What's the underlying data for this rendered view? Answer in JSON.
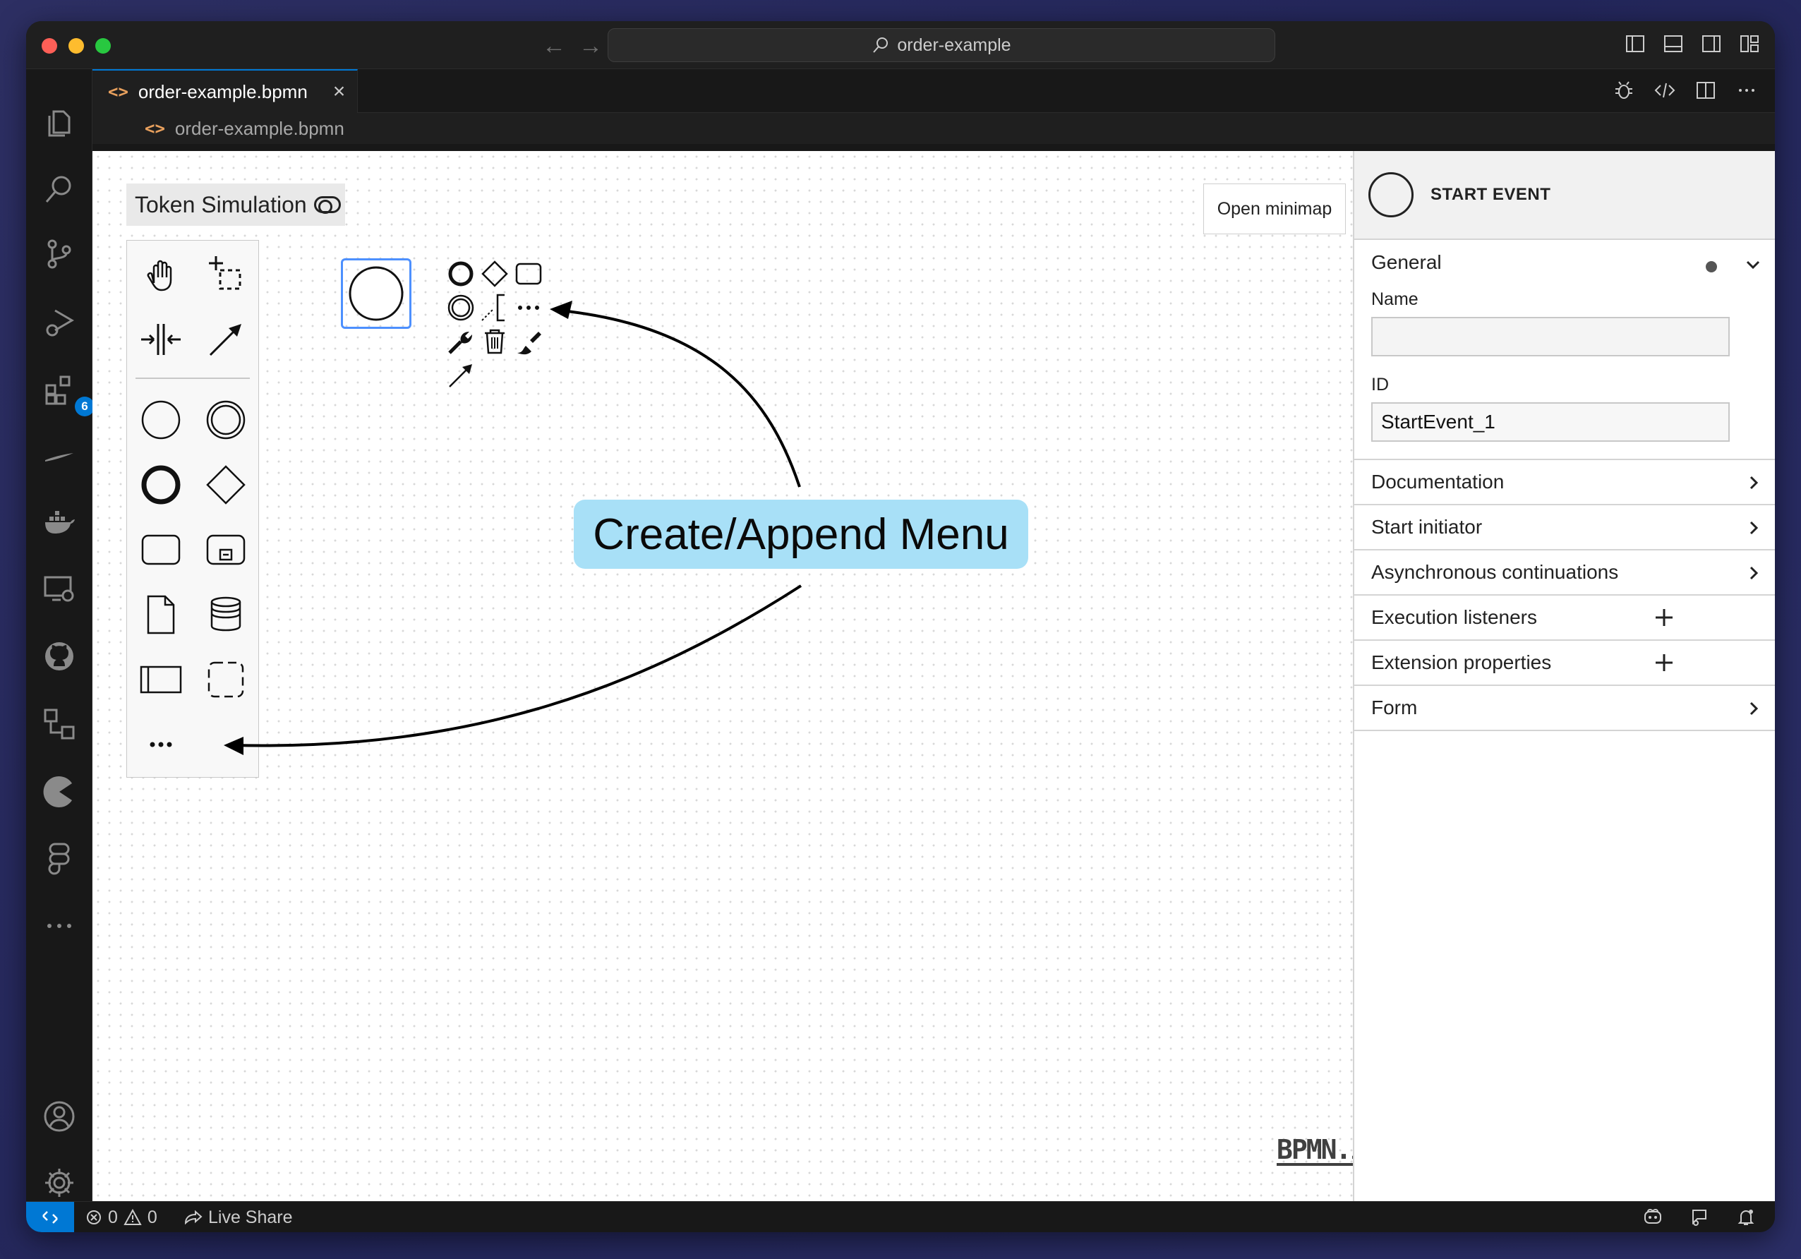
{
  "window": {
    "search_text": "order-example",
    "nav_back": "←",
    "nav_forward": "→"
  },
  "activity_bar": {
    "items": [
      {
        "name": "explorer",
        "icon": "files-icon"
      },
      {
        "name": "search",
        "icon": "search-icon"
      },
      {
        "name": "source-control",
        "icon": "source-control-icon"
      },
      {
        "name": "run-debug",
        "icon": "run-debug-icon"
      },
      {
        "name": "extensions",
        "icon": "extensions-icon",
        "badge": "6"
      },
      {
        "name": "fork",
        "icon": "fork-icon"
      },
      {
        "name": "docker",
        "icon": "docker-icon"
      },
      {
        "name": "remote-explorer",
        "icon": "remote-explorer-icon"
      },
      {
        "name": "github",
        "icon": "github-icon"
      },
      {
        "name": "flow",
        "icon": "flow-icon"
      },
      {
        "name": "pac-man",
        "icon": "pacman-icon"
      },
      {
        "name": "figma",
        "icon": "figma-icon"
      },
      {
        "name": "more",
        "icon": "more-icon"
      }
    ],
    "bottom": [
      {
        "name": "accounts",
        "icon": "account-icon"
      },
      {
        "name": "manage",
        "icon": "gear-icon"
      }
    ]
  },
  "tab": {
    "glyph": "<>",
    "label": "order-example.bpmn",
    "close": "×"
  },
  "breadcrumb": {
    "glyph": "<>",
    "label": "order-example.bpmn"
  },
  "canvas": {
    "token_simulation": "Token Simulation",
    "open_minimap": "Open minimap",
    "annotation": "Create/Append Menu",
    "logo": "BPMN.iO",
    "palette_tools": [
      "hand-tool-icon",
      "lasso-tool-icon",
      "space-tool-icon",
      "global-connect-icon",
      "start-event-icon",
      "intermediate-event-icon",
      "end-event-icon",
      "gateway-icon",
      "task-icon",
      "subprocess-icon",
      "data-object-icon",
      "data-store-icon",
      "pool-icon",
      "group-icon",
      "more-tools-icon"
    ],
    "context_pad": [
      "append-end-event-icon",
      "append-gateway-icon",
      "append-task-icon",
      "append-intermediate-event-icon",
      "append-text-annotation-icon",
      "more-options-icon",
      "change-type-icon",
      "delete-icon",
      "set-color-icon",
      "connect-icon"
    ]
  },
  "properties": {
    "title": "START EVENT",
    "general": {
      "label": "General",
      "name_label": "Name",
      "name_value": "",
      "id_label": "ID",
      "id_value": "StartEvent_1"
    },
    "groups": [
      {
        "label": "Documentation",
        "action": "chevron-right-icon"
      },
      {
        "label": "Start initiator",
        "action": "chevron-right-icon"
      },
      {
        "label": "Asynchronous continuations",
        "action": "chevron-right-icon"
      },
      {
        "label": "Execution listeners",
        "action": "plus-icon"
      },
      {
        "label": "Extension properties",
        "action": "plus-icon"
      },
      {
        "label": "Form",
        "action": "chevron-right-icon"
      }
    ]
  },
  "status_bar": {
    "errors": "0",
    "warnings": "0",
    "live_share": "Live Share"
  },
  "colors": {
    "accent": "#0078d4",
    "annotation_bg": "#a8e0f7",
    "selection": "#4d90fe"
  }
}
